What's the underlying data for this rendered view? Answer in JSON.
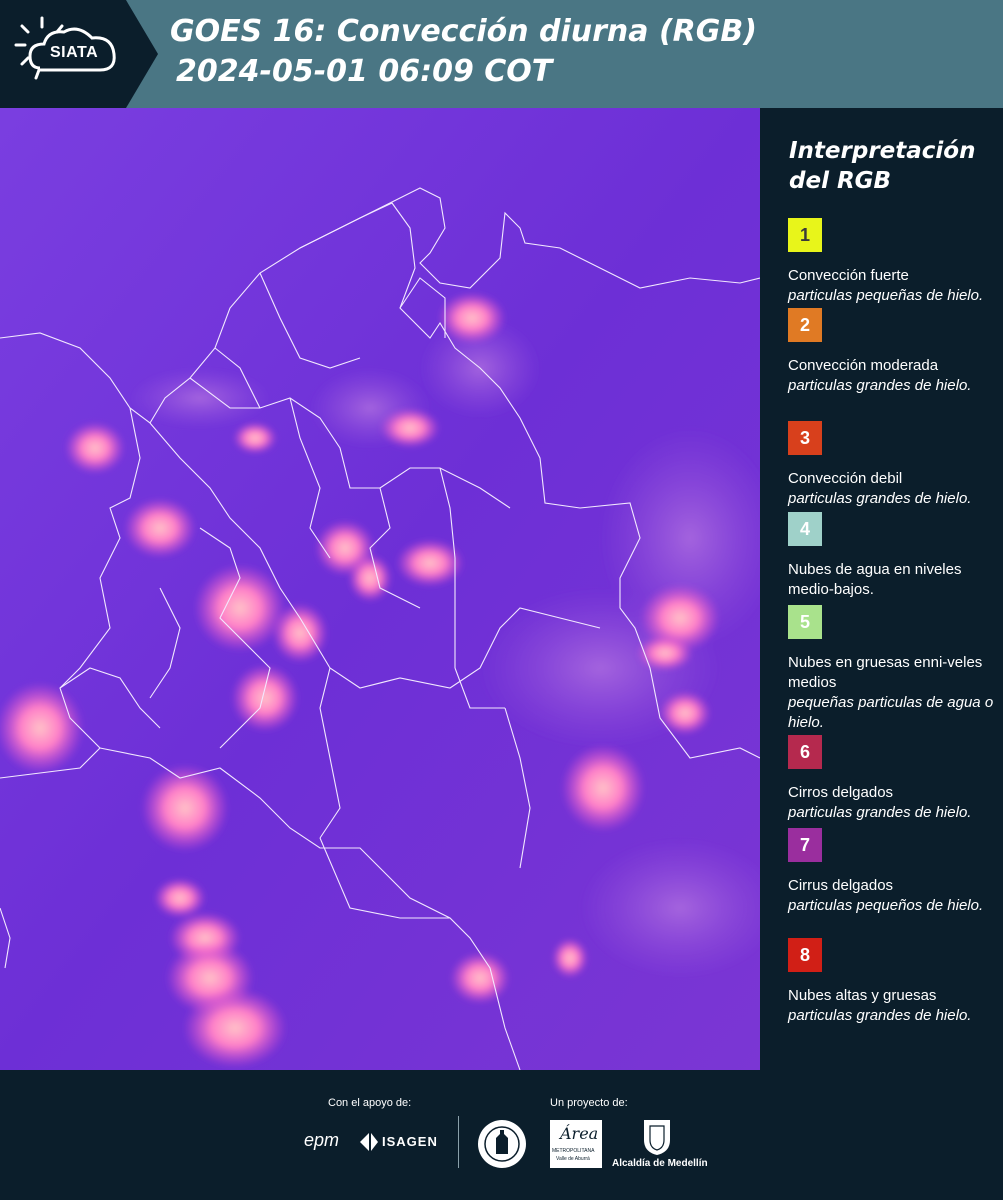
{
  "header": {
    "brand": "SIATA",
    "title_line1": "GOES 16: Convección diurna (RGB)",
    "title_line2": "2024-05-01 06:09 COT"
  },
  "legend": {
    "title_line1": "Interpretación",
    "title_line2": "del RGB",
    "items": [
      {
        "number": "1",
        "color": "#e8f51a",
        "text_color": "#3a3a3a",
        "label": "Convección fuerte",
        "desc": "particulas pequeñas de hielo."
      },
      {
        "number": "2",
        "color": "#e07a24",
        "text_color": "#ffffff",
        "label": "Convección moderada",
        "desc": "particulas grandes de hielo."
      },
      {
        "number": "3",
        "color": "#d8401c",
        "text_color": "#ffffff",
        "label": "Convección debil",
        "desc": "particulas grandes de hielo."
      },
      {
        "number": "4",
        "color": "#9fd1c9",
        "text_color": "#ffffff",
        "label": "Nubes de agua en niveles medio-bajos.",
        "desc": ""
      },
      {
        "number": "5",
        "color": "#a9e28c",
        "text_color": "#ffffff",
        "label": "Nubes en gruesas enni-veles medios",
        "desc": "pequeñas particulas de agua o hielo."
      },
      {
        "number": "6",
        "color": "#b5294e",
        "text_color": "#ffffff",
        "label": "Cirros delgados",
        "desc": "particulas grandes de hielo."
      },
      {
        "number": "7",
        "color": "#9a2e9e",
        "text_color": "#ffffff",
        "label": "Cirrus delgados",
        "desc": "particulas pequeños de hielo."
      },
      {
        "number": "8",
        "color": "#d11f16",
        "text_color": "#ffffff",
        "label": "Nubes altas y gruesas",
        "desc": "particulas grandes de hielo."
      }
    ]
  },
  "footer": {
    "support_caption": "Con el apoyo de:",
    "project_caption": "Un proyecto de:",
    "sponsor_epm": "epm",
    "sponsor_isagen": "ISAGEN",
    "area_logo_text": "Área",
    "area_sub1": "METROPOLITANA",
    "area_sub2": "Valle de Aburrá",
    "alcaldia": "Alcaldía de Medellín"
  }
}
